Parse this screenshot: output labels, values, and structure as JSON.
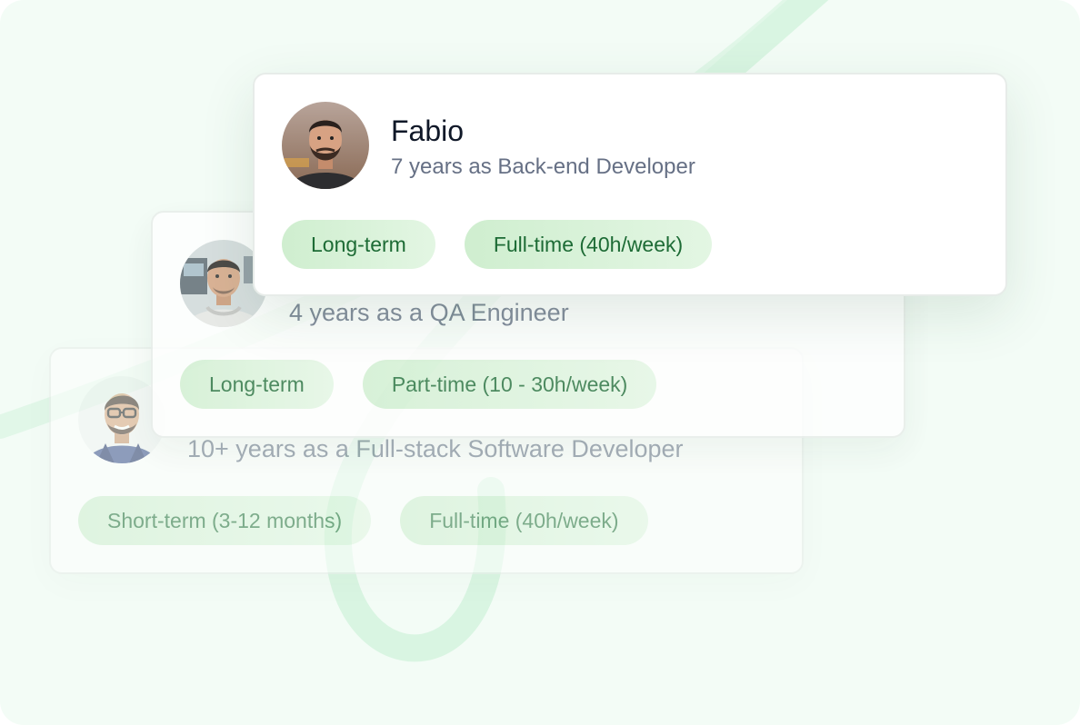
{
  "profiles": [
    {
      "name": "Fabio",
      "role": "7 years as Back-end Developer",
      "avatar_icon": "person-photo-icon",
      "tags": [
        "Long-term",
        "Full-time (40h/week)"
      ]
    },
    {
      "name": "",
      "role": "4 years as a QA Engineer",
      "avatar_icon": "person-photo-icon",
      "tags": [
        "Long-term",
        "Part-time (10 - 30h/week)"
      ]
    },
    {
      "name": "",
      "role": "10+ years as a Full-stack Software Developer",
      "avatar_icon": "person-photo-icon",
      "tags": [
        "Short-term (3-12 months)",
        "Full-time (40h/week)"
      ]
    }
  ],
  "colors": {
    "background": "#f3fcf6",
    "card": "#ffffff",
    "tag_bg": "#d6f1d6",
    "tag_text": "#1d6b35",
    "name_text": "#101828",
    "role_text": "#667085",
    "swoosh": "#d9f5e2"
  }
}
